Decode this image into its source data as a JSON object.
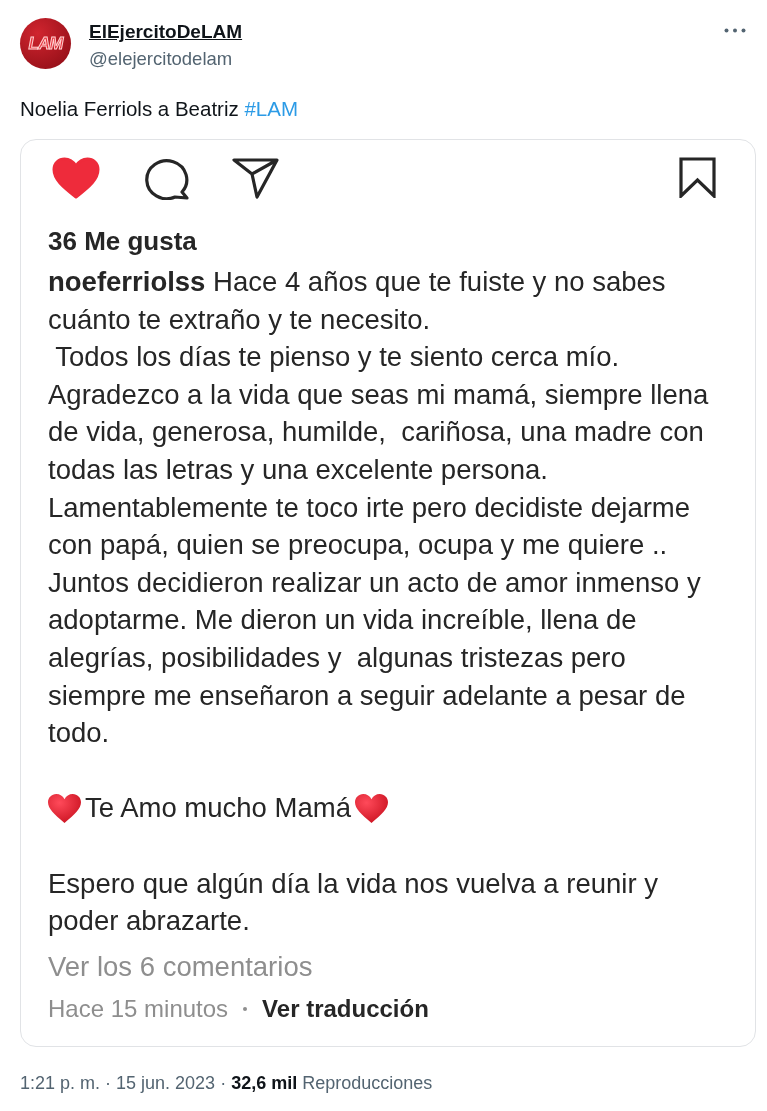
{
  "author": {
    "name": "ElEjercitoDeLAM",
    "handle": "@elejercitodelam",
    "avatar_text": "LAM"
  },
  "tweet": {
    "text": "Noelia Ferriols a Beatriz",
    "hashtag": "#LAM"
  },
  "post": {
    "liked": true,
    "saved": false,
    "likes": "36 Me gusta",
    "username": "noeferriolss",
    "caption_lines": [
      "Hace 4 años que te fuiste y no sabes",
      "cuánto te extraño y te necesito.",
      " Todos los días te pienso y te siento cerca mío.",
      "Agradezco a la vida que seas mi mamá, siempre llena",
      "de vida, generosa, humilde,  cariñosa, una madre con",
      "todas las letras y una excelente persona.",
      "Lamentablemente te toco irte pero decidiste dejarme",
      "con papá, quien se preocupa, ocupa y me quiere ..",
      "Juntos decidieron realizar un acto de amor inmenso y",
      "adoptarme. Me dieron un vida increíble, llena de",
      "alegrías, posibilidades y  algunas tristezas pero",
      "siempre me enseñaron a seguir adelante a pesar de",
      "todo."
    ],
    "love_line": "Te Amo mucho Mamá",
    "closing_lines": [
      "Espero que algún día la vida nos vuelva a reunir y",
      "poder abrazarte."
    ],
    "comments_link": "Ver los 6 comentarios",
    "time_ago": "Hace 15 minutos",
    "translate_link": "Ver traducción"
  },
  "footer": {
    "text": "1:21 p. m. · 15 jun. 2023 · **32,6 mil** Reproducciones"
  }
}
